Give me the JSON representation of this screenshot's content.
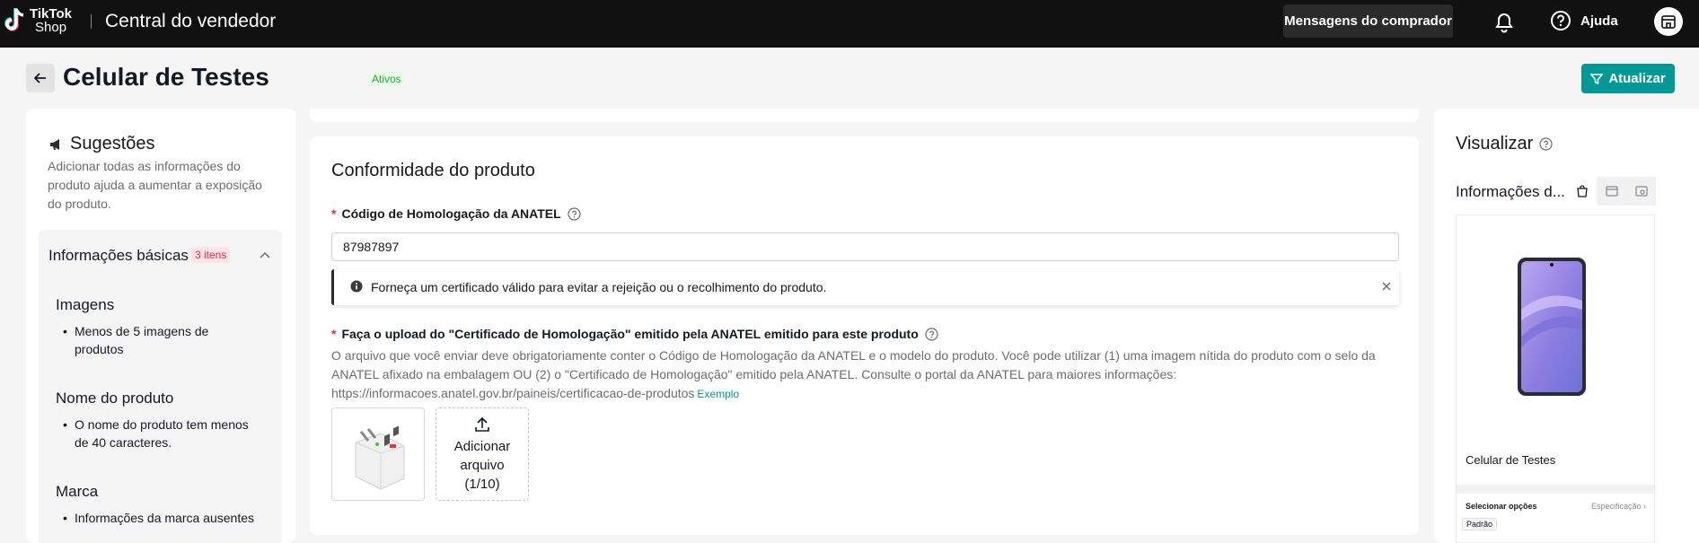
{
  "header": {
    "logo_line1": "TikTok",
    "logo_line2": "Shop",
    "app_title": "Central do vendedor",
    "messages_button": "Mensagens do comprador",
    "help_label": "Ajuda",
    "icons": [
      "tiktok-logo-icon",
      "bell-icon",
      "help-icon",
      "store-icon"
    ]
  },
  "page": {
    "title": "Celular de Testes",
    "status": "Ativos",
    "update_button": "Atualizar"
  },
  "suggestions": {
    "title": "Sugestões",
    "description": "Adicionar todas as informações do produto ajuda a aumentar a exposição do produto.",
    "group_title": "Informações básicas",
    "group_count": "3 itens",
    "sections": [
      {
        "title": "Imagens",
        "item": "Menos de 5 imagens de produtos"
      },
      {
        "title": "Nome do produto",
        "item": "O nome do produto tem menos de 40 caracteres."
      },
      {
        "title": "Marca",
        "item": "Informações da marca ausentes"
      }
    ]
  },
  "compliance": {
    "title": "Conformidade do produto",
    "anatel_label": "Código de Homologação da ANATEL",
    "anatel_value": "87987897",
    "alert_text": "Forneça um certificado válido para evitar a rejeição ou o recolhimento do produto.",
    "upload_label": "Faça o upload do \"Certificado de Homologação\" emitido pela ANATEL emitido para este produto",
    "upload_desc": "O arquivo que você enviar deve obrigatoriamente conter o Código de Homologação da ANATEL e o modelo do produto. Você pode utilizar (1) uma imagem nítida do produto com o selo da ANATEL afixado na embalagem OU (2) o \"Certificado de Homologação\" emitido pela ANATEL. Consulte o portal da ANATEL para maiores informações: https://informacoes.anatel.gov.br/paineis/certificacao-de-produtos",
    "example_link": "Exemplo",
    "add_file_line1": "Adicionar",
    "add_file_line2": "arquivo",
    "add_file_count": "(1/10)"
  },
  "preview": {
    "title": "Visualizar",
    "info_label": "Informações d...",
    "product_name": "Celular de Testes",
    "select_options": "Selecionar opções",
    "spec_link": "Especificação ›",
    "option_value": "Padrão"
  },
  "colors": {
    "accent": "#009995",
    "topbar": "#111111",
    "status_green": "#2aa830",
    "badge_red": "#e52b3d"
  }
}
